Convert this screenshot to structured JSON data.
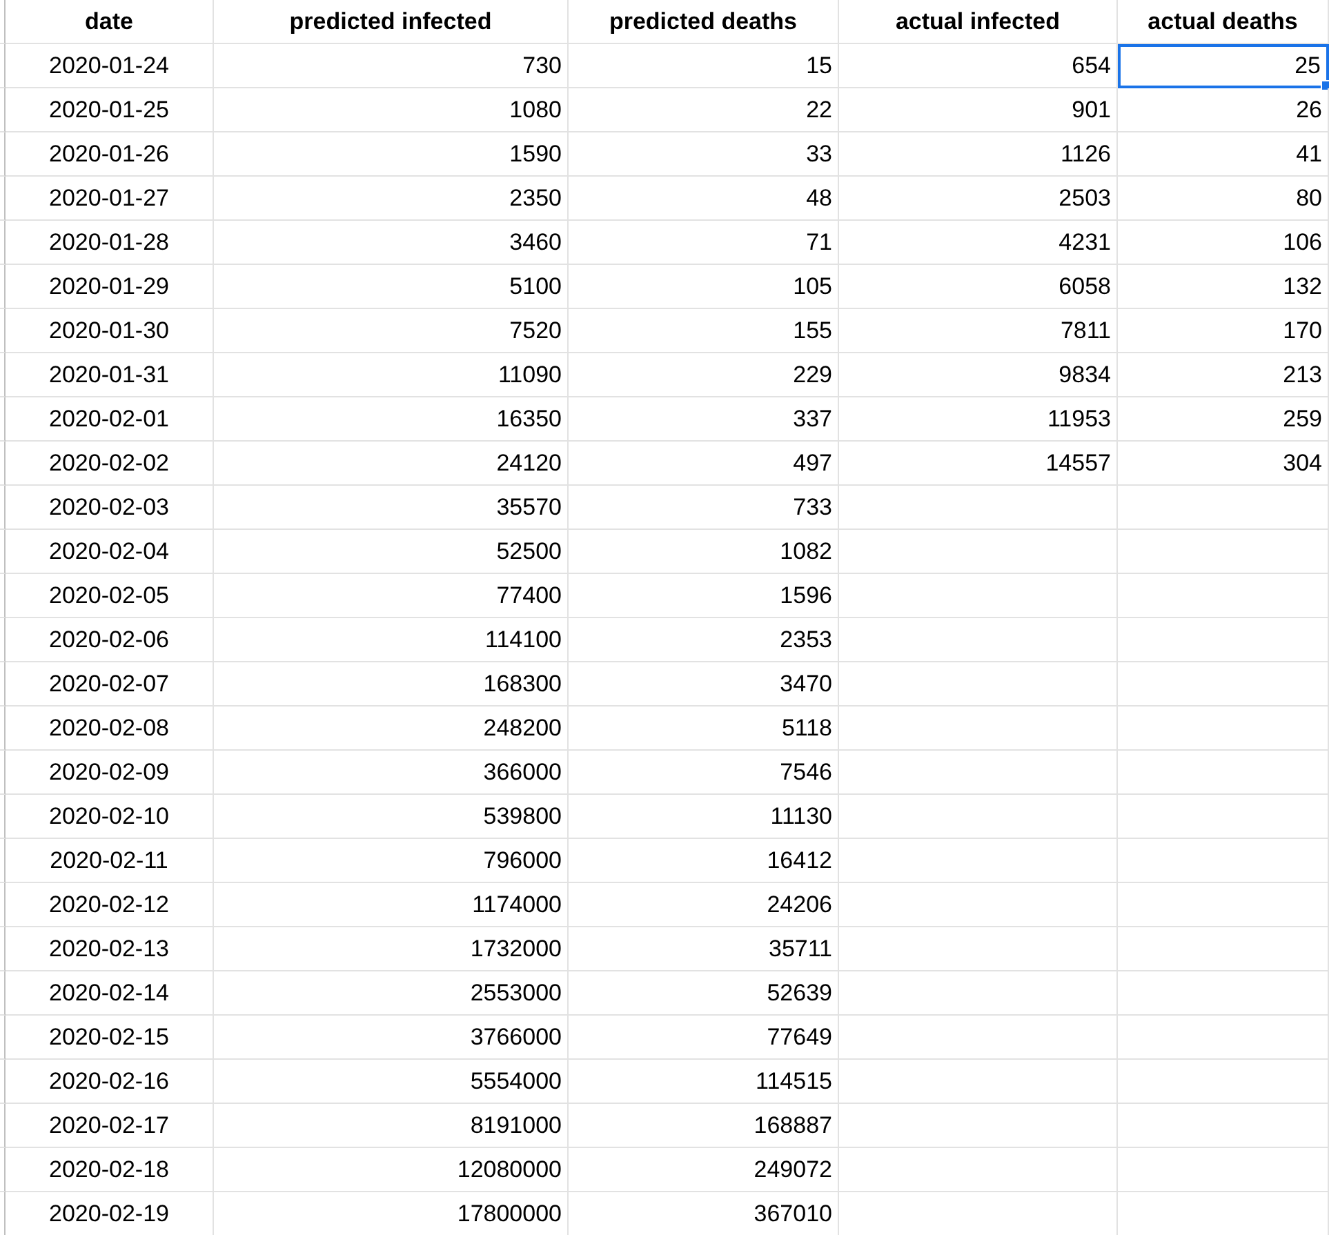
{
  "table": {
    "columns": [
      "date",
      "predicted infected",
      "predicted deaths",
      "actual infected",
      "actual deaths"
    ],
    "rows": [
      [
        {
          "text": "2020-01-24",
          "selected": false
        },
        {
          "text": "730",
          "selected": false
        },
        {
          "text": "15",
          "selected": false
        },
        {
          "text": "654",
          "selected": false
        },
        {
          "text": "25",
          "selected": true
        }
      ],
      [
        {
          "text": "2020-01-25",
          "selected": false
        },
        {
          "text": "1080",
          "selected": false
        },
        {
          "text": "22",
          "selected": false
        },
        {
          "text": "901",
          "selected": false
        },
        {
          "text": "26",
          "selected": false
        }
      ],
      [
        {
          "text": "2020-01-26",
          "selected": false
        },
        {
          "text": "1590",
          "selected": false
        },
        {
          "text": "33",
          "selected": false
        },
        {
          "text": "1126",
          "selected": false
        },
        {
          "text": "41",
          "selected": false
        }
      ],
      [
        {
          "text": "2020-01-27",
          "selected": false
        },
        {
          "text": "2350",
          "selected": false
        },
        {
          "text": "48",
          "selected": false
        },
        {
          "text": "2503",
          "selected": false
        },
        {
          "text": "80",
          "selected": false
        }
      ],
      [
        {
          "text": "2020-01-28",
          "selected": false
        },
        {
          "text": "3460",
          "selected": false
        },
        {
          "text": "71",
          "selected": false
        },
        {
          "text": "4231",
          "selected": false
        },
        {
          "text": "106",
          "selected": false
        }
      ],
      [
        {
          "text": "2020-01-29",
          "selected": false
        },
        {
          "text": "5100",
          "selected": false
        },
        {
          "text": "105",
          "selected": false
        },
        {
          "text": "6058",
          "selected": false
        },
        {
          "text": "132",
          "selected": false
        }
      ],
      [
        {
          "text": "2020-01-30",
          "selected": false
        },
        {
          "text": "7520",
          "selected": false
        },
        {
          "text": "155",
          "selected": false
        },
        {
          "text": "7811",
          "selected": false
        },
        {
          "text": "170",
          "selected": false
        }
      ],
      [
        {
          "text": "2020-01-31",
          "selected": false
        },
        {
          "text": "11090",
          "selected": false
        },
        {
          "text": "229",
          "selected": false
        },
        {
          "text": "9834",
          "selected": false
        },
        {
          "text": "213",
          "selected": false
        }
      ],
      [
        {
          "text": "2020-02-01",
          "selected": false
        },
        {
          "text": "16350",
          "selected": false
        },
        {
          "text": "337",
          "selected": false
        },
        {
          "text": "11953",
          "selected": false
        },
        {
          "text": "259",
          "selected": false
        }
      ],
      [
        {
          "text": "2020-02-02",
          "selected": false
        },
        {
          "text": "24120",
          "selected": false
        },
        {
          "text": "497",
          "selected": false
        },
        {
          "text": "14557",
          "selected": false
        },
        {
          "text": "304",
          "selected": false
        }
      ],
      [
        {
          "text": "2020-02-03",
          "selected": false
        },
        {
          "text": "35570",
          "selected": false
        },
        {
          "text": "733",
          "selected": false
        }
      ],
      [
        {
          "text": "2020-02-04",
          "selected": false
        },
        {
          "text": "52500",
          "selected": false
        },
        {
          "text": "1082",
          "selected": false
        }
      ],
      [
        {
          "text": "2020-02-05",
          "selected": false
        },
        {
          "text": "77400",
          "selected": false
        },
        {
          "text": "1596",
          "selected": false
        }
      ],
      [
        {
          "text": "2020-02-06",
          "selected": false
        },
        {
          "text": "114100",
          "selected": false
        },
        {
          "text": "2353",
          "selected": false
        }
      ],
      [
        {
          "text": "2020-02-07",
          "selected": false
        },
        {
          "text": "168300",
          "selected": false
        },
        {
          "text": "3470",
          "selected": false
        }
      ],
      [
        {
          "text": "2020-02-08",
          "selected": false
        },
        {
          "text": "248200",
          "selected": false
        },
        {
          "text": "5118",
          "selected": false
        }
      ],
      [
        {
          "text": "2020-02-09",
          "selected": false
        },
        {
          "text": "366000",
          "selected": false
        },
        {
          "text": "7546",
          "selected": false
        }
      ],
      [
        {
          "text": "2020-02-10",
          "selected": false
        },
        {
          "text": "539800",
          "selected": false
        },
        {
          "text": "11130",
          "selected": false
        }
      ],
      [
        {
          "text": "2020-02-11",
          "selected": false
        },
        {
          "text": "796000",
          "selected": false
        },
        {
          "text": "16412",
          "selected": false
        }
      ],
      [
        {
          "text": "2020-02-12",
          "selected": false
        },
        {
          "text": "1174000",
          "selected": false
        },
        {
          "text": "24206",
          "selected": false
        }
      ],
      [
        {
          "text": "2020-02-13",
          "selected": false
        },
        {
          "text": "1732000",
          "selected": false
        },
        {
          "text": "35711",
          "selected": false
        }
      ],
      [
        {
          "text": "2020-02-14",
          "selected": false
        },
        {
          "text": "2553000",
          "selected": false
        },
        {
          "text": "52639",
          "selected": false
        }
      ],
      [
        {
          "text": "2020-02-15",
          "selected": false
        },
        {
          "text": "3766000",
          "selected": false
        },
        {
          "text": "77649",
          "selected": false
        }
      ],
      [
        {
          "text": "2020-02-16",
          "selected": false
        },
        {
          "text": "5554000",
          "selected": false
        },
        {
          "text": "114515",
          "selected": false
        }
      ],
      [
        {
          "text": "2020-02-17",
          "selected": false
        },
        {
          "text": "8191000",
          "selected": false
        },
        {
          "text": "168887",
          "selected": false
        }
      ],
      [
        {
          "text": "2020-02-18",
          "selected": false
        },
        {
          "text": "12080000",
          "selected": false
        },
        {
          "text": "249072",
          "selected": false
        }
      ],
      [
        {
          "text": "2020-02-19",
          "selected": false
        },
        {
          "text": "17800000",
          "selected": false
        },
        {
          "text": "367010",
          "selected": false
        }
      ]
    ]
  }
}
